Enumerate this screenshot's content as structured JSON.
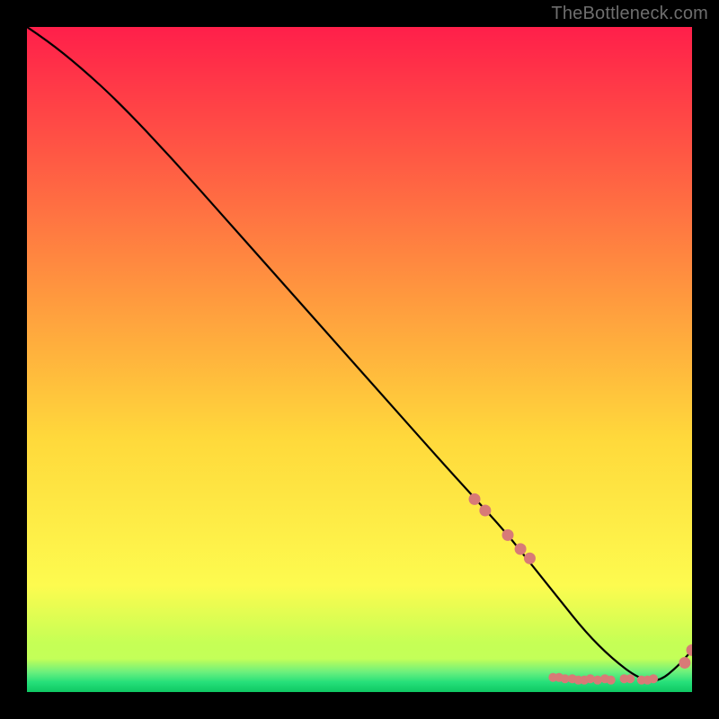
{
  "watermark": "TheBottleneck.com",
  "colors": {
    "frame": "#000000",
    "curve": "#000000",
    "marker_fill": "#d87a77",
    "marker_stroke": "#a74d4a",
    "grad_top": "#ff1f4a",
    "grad_upper": "#ff6a3e",
    "grad_mid": "#ffd93b",
    "grad_low": "#f6ff55",
    "grad_bottom_y": "#c6ff55",
    "grad_green": "#26e07a",
    "grad_deepgreen": "#0fc763"
  },
  "chart_data": {
    "type": "line",
    "title": "",
    "xlabel": "",
    "ylabel": "",
    "xlim": [
      0,
      100
    ],
    "ylim": [
      0,
      100
    ],
    "note": "Axes are unlabeled in the source image; values are normalized 0–100. Curve traces the black line; markers_on_curve are points that lie on the curve (the descending cluster and the two on the rising tail). markers_flat are the string of near-baseline markers around the valley.",
    "series": [
      {
        "name": "curve",
        "x": [
          0,
          3,
          8,
          14,
          22,
          30,
          38,
          46,
          54,
          62,
          67,
          72,
          76,
          80,
          84,
          88,
          92,
          95,
          98,
          100
        ],
        "y": [
          100,
          98,
          94,
          88.5,
          80,
          71,
          62,
          53,
          44,
          35,
          29.5,
          24,
          19,
          14,
          9,
          5,
          2,
          1.5,
          4,
          6.3
        ]
      }
    ],
    "markers_on_curve": {
      "x": [
        67.3,
        68.9,
        72.3,
        74.2,
        75.6,
        98.9,
        100.0
      ],
      "y": [
        29.0,
        27.3,
        23.6,
        21.5,
        20.1,
        4.4,
        6.3
      ]
    },
    "markers_flat": {
      "x": [
        79.1,
        80.0,
        80.9,
        82.0,
        82.9,
        83.8,
        84.7,
        85.8,
        86.9,
        87.8,
        89.8,
        90.7,
        92.4,
        93.3,
        94.2
      ],
      "y": [
        2.2,
        2.2,
        2.0,
        2.0,
        1.8,
        1.8,
        2.0,
        1.8,
        2.0,
        1.8,
        2.0,
        2.0,
        1.8,
        1.8,
        2.0
      ]
    }
  }
}
